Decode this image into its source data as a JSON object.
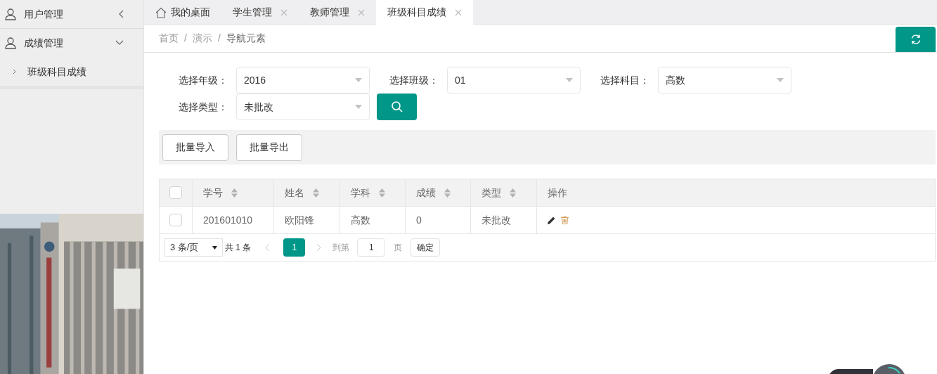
{
  "sidebar": {
    "items": [
      {
        "label": "用户管理",
        "expanded": false
      },
      {
        "label": "成绩管理",
        "expanded": true,
        "children": [
          {
            "label": "班级科目成绩"
          }
        ]
      }
    ]
  },
  "tabs": [
    {
      "label": "我的桌面",
      "kind": "home",
      "selected": false
    },
    {
      "label": "学生管理",
      "kind": "closable",
      "selected": false
    },
    {
      "label": "教师管理",
      "kind": "closable",
      "selected": false
    },
    {
      "label": "班级科目成绩",
      "kind": "closable",
      "selected": true
    }
  ],
  "breadcrumb": [
    "首页",
    "演示",
    "导航元素"
  ],
  "breadcrumb_separator": "/",
  "filters": [
    {
      "label": "选择年级：",
      "value": "2016"
    },
    {
      "label": "选择班级：",
      "value": "01"
    },
    {
      "label": "选择科目：",
      "value": "高数"
    },
    {
      "label": "选择类型：",
      "value": "未批改"
    }
  ],
  "toolbar": [
    "批量导入",
    "批量导出"
  ],
  "table": {
    "columns": [
      {
        "label": "学号",
        "sortable": true
      },
      {
        "label": "姓名",
        "sortable": true
      },
      {
        "label": "学科",
        "sortable": true
      },
      {
        "label": "成绩",
        "sortable": true
      },
      {
        "label": "类型",
        "sortable": true
      },
      {
        "label": "操作",
        "sortable": false
      }
    ],
    "header_checked": false,
    "rows": [
      {
        "checked": false,
        "cells": [
          "201601010",
          "欧阳锋",
          "高数",
          "0",
          "未批改"
        ]
      }
    ]
  },
  "pagination": {
    "page_size": "3 条/页",
    "total": "共 1 条",
    "pages": [
      {
        "label": "1",
        "selected": true
      }
    ],
    "goto_label": "到第",
    "goto_value": "1",
    "page_unit": "页",
    "confirm": "确定"
  }
}
